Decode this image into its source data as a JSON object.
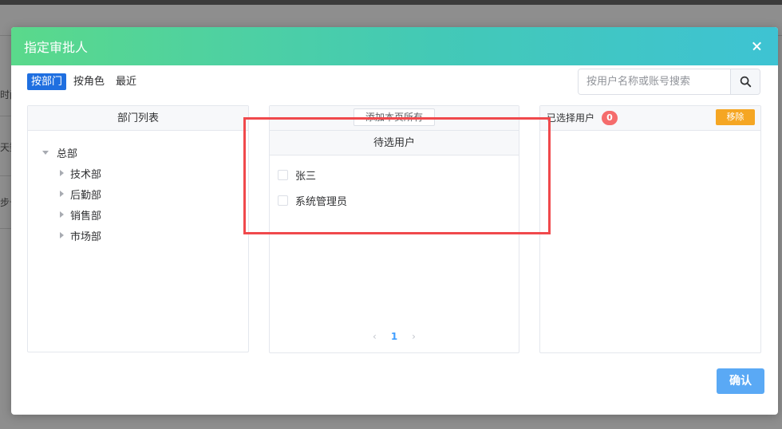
{
  "background": {
    "fragments": [
      "时间",
      "天数",
      "步号"
    ]
  },
  "dialog": {
    "title": "指定审批人",
    "tabs": [
      "按部门",
      "按角色",
      "最近"
    ],
    "search": {
      "placeholder": "按用户名称或账号搜索"
    },
    "left_panel": {
      "title": "部门列表",
      "root": "总部",
      "children": [
        "技术部",
        "后勤部",
        "销售部",
        "市场部"
      ]
    },
    "middle_panel": {
      "add_all_button": "添加本页所有",
      "title": "待选用户",
      "users": [
        "张三",
        "系统管理员"
      ],
      "pagination": {
        "prev": "‹",
        "page": "1",
        "next": "›"
      }
    },
    "right_panel": {
      "title": "已选择用户",
      "count": "0",
      "remove_button": "移除"
    },
    "confirm_button": "确认"
  },
  "colors": {
    "header_gradient_start": "#5ad98b",
    "header_gradient_end": "#3ec3d3",
    "active_tab": "#1f6fe0",
    "badge": "#f56c6c",
    "remove_button": "#f5a623",
    "confirm_button": "#5aa9f5",
    "highlight_box": "#f0494c"
  },
  "icons": {
    "close": "close-icon",
    "search": "search-icon"
  }
}
